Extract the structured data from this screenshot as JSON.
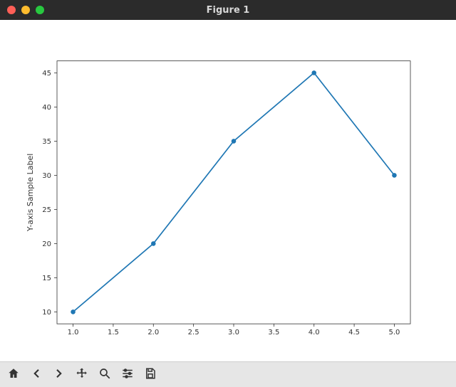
{
  "window": {
    "title": "Figure 1"
  },
  "toolbar": {
    "home": "Home",
    "back": "Back",
    "forward": "Forward",
    "pan": "Pan",
    "zoom": "Zoom",
    "configure": "Configure subplots",
    "save": "Save"
  },
  "chart_data": {
    "type": "line",
    "x": [
      1,
      2,
      3,
      4,
      5
    ],
    "y": [
      10,
      20,
      35,
      45,
      30
    ],
    "xlabel": "",
    "ylabel": "Y-axis Sample Label",
    "xlim": [
      0.8,
      5.2
    ],
    "ylim": [
      8.25,
      46.75
    ],
    "xticks": [
      1.0,
      1.5,
      2.0,
      2.5,
      3.0,
      3.5,
      4.0,
      4.5,
      5.0
    ],
    "yticks": [
      10,
      15,
      20,
      25,
      30,
      35,
      40,
      45
    ],
    "xtick_labels": [
      "1.0",
      "1.5",
      "2.0",
      "2.5",
      "3.0",
      "3.5",
      "4.0",
      "4.5",
      "5.0"
    ],
    "ytick_labels": [
      "10",
      "15",
      "20",
      "25",
      "30",
      "35",
      "40",
      "45"
    ],
    "line_color": "#1f77b4",
    "marker": "o"
  }
}
